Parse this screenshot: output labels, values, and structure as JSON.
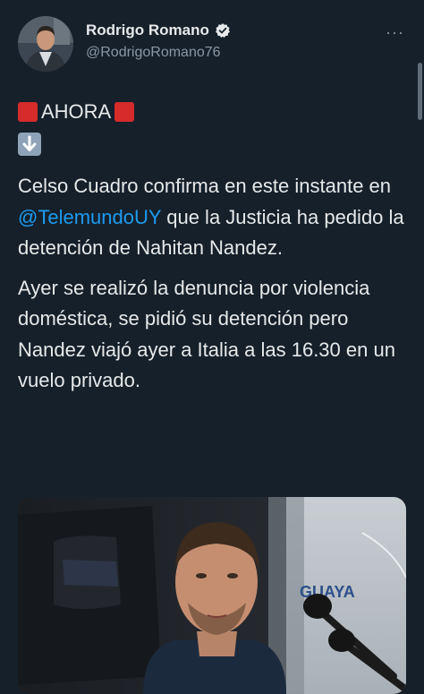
{
  "author": {
    "display_name": "Rodrigo Romano",
    "handle": "@RodrigoRomano76",
    "verified": true
  },
  "more_label": "···",
  "tweet": {
    "prefix_emoji": "red-square",
    "headline": "AHORA",
    "suffix_emoji": "red-square",
    "arrow_emoji": "down-arrow",
    "paragraph1_before": "Celso Cuadro confirma en este instante en ",
    "mention": "@TelemundoUY",
    "paragraph1_after": " que la Justicia ha pedido la detención de Nahitan Nandez.",
    "paragraph2": "Ayer se realizó la denuncia por violencia doméstica, se pidió su detención pero Nandez viajó ayer a Italia a las 16.30 en un vuelo privado."
  },
  "media": {
    "backdrop_text": "GUAYA"
  },
  "colors": {
    "background": "#15202b",
    "text": "#e7e9ea",
    "secondary": "#8b98a5",
    "link": "#1d9bf0",
    "verified_badge": "#e7e9ea",
    "emoji_red": "#d62b2b"
  }
}
